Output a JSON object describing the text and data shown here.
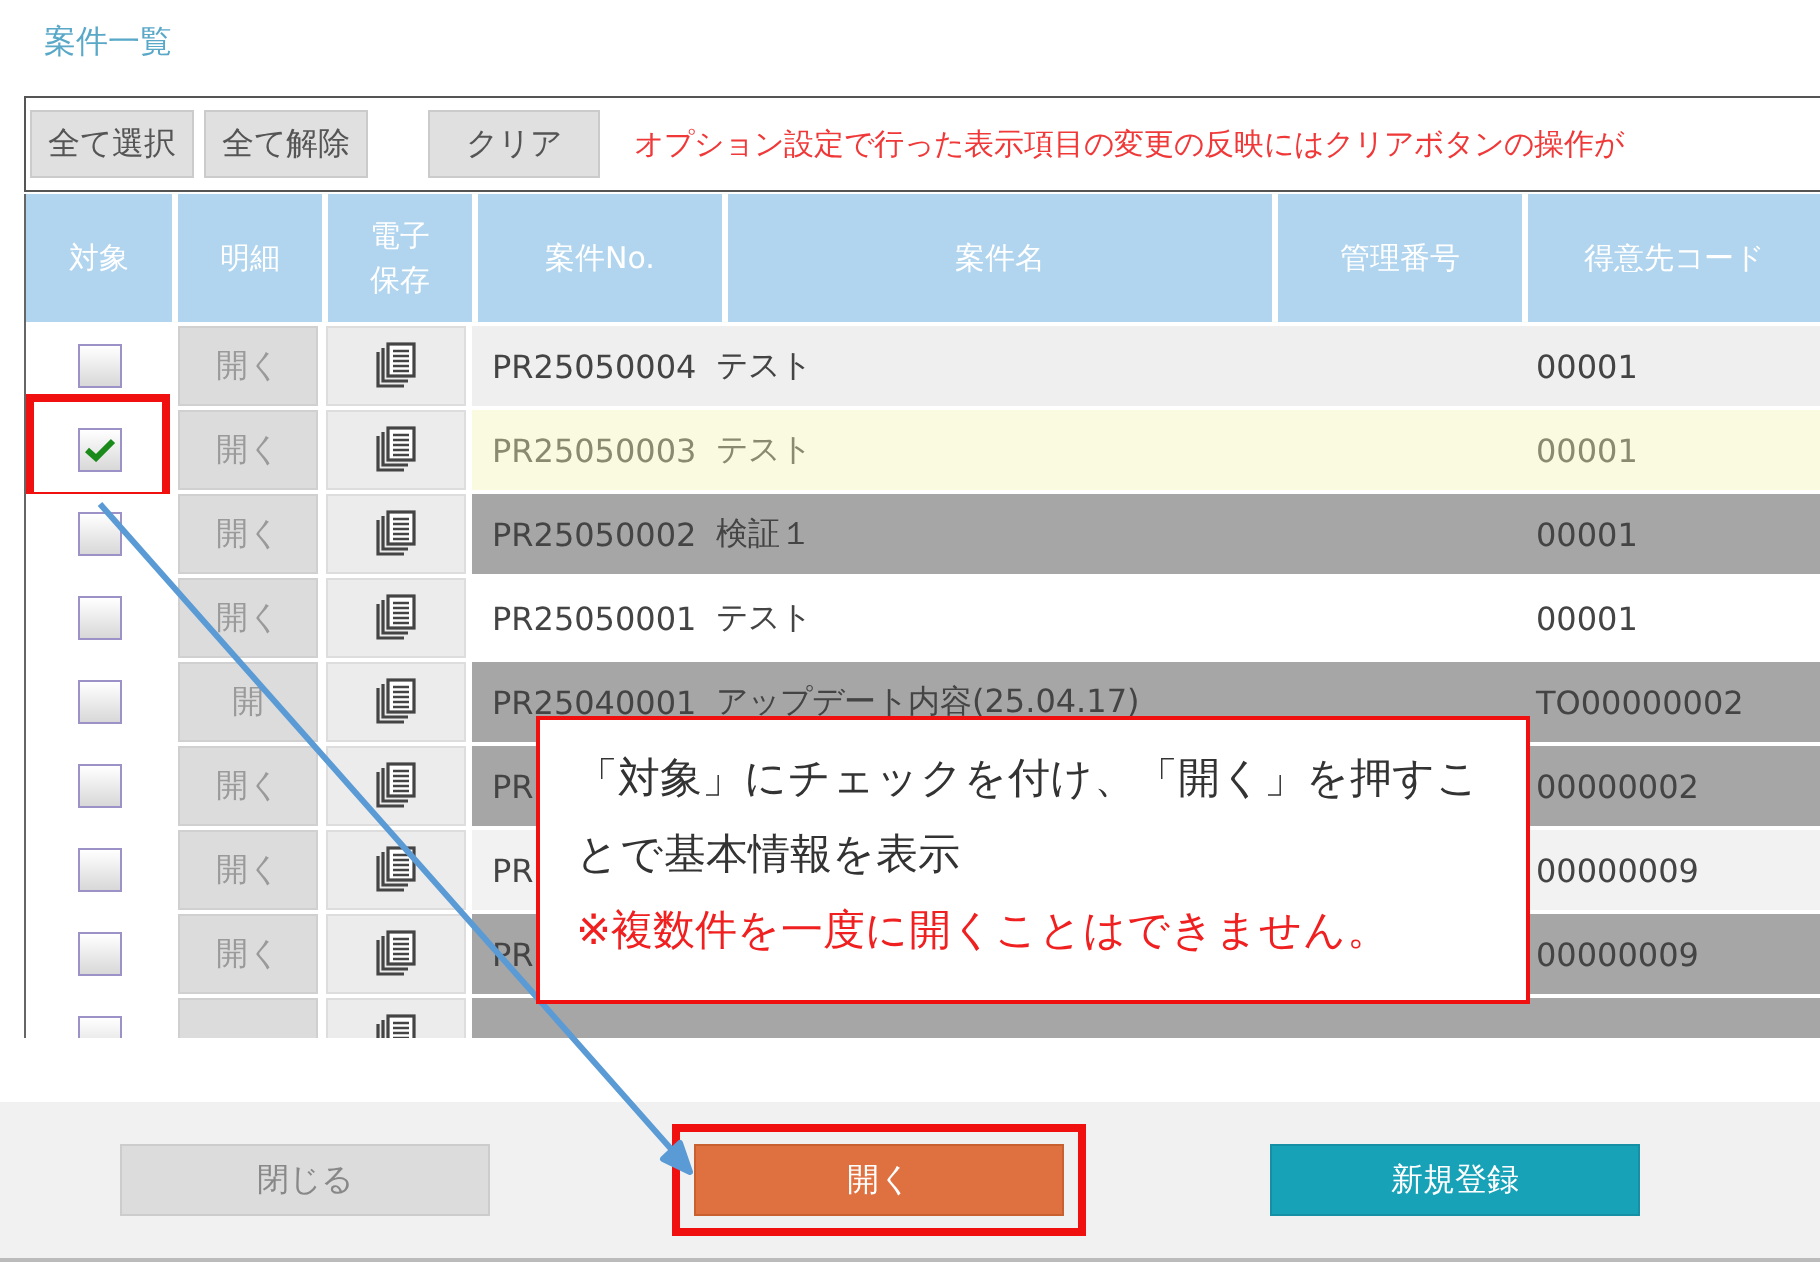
{
  "title": "案件一覧",
  "toolbar": {
    "buttons": [
      "全て選択",
      "全て解除",
      "クリア"
    ],
    "notice": "オプション設定で行った表示項目の変更の反映にはクリアボタンの操作が"
  },
  "table": {
    "columns": [
      "対象",
      "明細",
      "電子保存",
      "案件No.",
      "案件名",
      "管理番号",
      "得意先コード"
    ],
    "rows": [
      {
        "checked": false,
        "highlighted": false,
        "color": "#efefef",
        "detail": "開く",
        "number": "PR25050004",
        "name": "テスト",
        "code": "00001"
      },
      {
        "checked": true,
        "highlighted": true,
        "detail": "開く",
        "number": "PR25050003",
        "name": "テスト",
        "code": "00001"
      },
      {
        "checked": false,
        "highlighted": false,
        "color": "#a6a6a6",
        "detail": "開く",
        "number": "PR25050002",
        "name": "検証１",
        "code": "00001"
      },
      {
        "checked": false,
        "highlighted": false,
        "color": "#ffffff",
        "detail": "開く",
        "number": "PR25050001",
        "name": "テスト",
        "code": "00001"
      },
      {
        "checked": false,
        "highlighted": false,
        "color": "#a6a6a6",
        "detail": "開",
        "number": "PR25040001",
        "name": "アップデート内容(25.04.17)",
        "code": "TO00000002"
      },
      {
        "checked": false,
        "highlighted": false,
        "color": "#a6a6a6",
        "detail": "開く",
        "number": "PR",
        "code": "00000002"
      },
      {
        "checked": false,
        "highlighted": false,
        "color": "#f2f2f2",
        "detail": "開く",
        "number": "PR",
        "code": "00000009"
      },
      {
        "checked": false,
        "highlighted": false,
        "color": "#a6a6a6",
        "detail": "開く",
        "number": "PR",
        "code": "00000009"
      },
      {
        "checked": false,
        "highlighted": false,
        "color": "#a6a6a6"
      }
    ]
  },
  "callout": {
    "text": "「対象」にチェックを付け、「開く」を押すことで基本情報を表示",
    "note": "※複数件を一度に開くことはできません。"
  },
  "footer": {
    "buttons": [
      {
        "label": "閉じる",
        "kind": "close",
        "highlighted": false
      },
      {
        "label": "開く",
        "kind": "open",
        "highlighted": true
      },
      {
        "label": "新規登録",
        "kind": "register",
        "highlighted": false
      }
    ]
  }
}
